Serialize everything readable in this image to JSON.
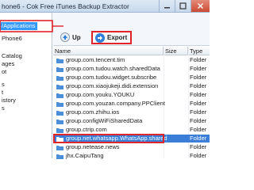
{
  "window": {
    "title": "hone6 - Cok Free iTunes Backup Extractor",
    "btn_minimize": "minimize-icon",
    "btn_maximize": "maximize-icon",
    "btn_close": "close-icon"
  },
  "tree": {
    "items": [
      {
        "label": "/Applications",
        "selected": true
      },
      {
        "label": "Phone6"
      },
      {
        "label": "Catalog"
      },
      {
        "label": "ages"
      },
      {
        "label": "ot"
      },
      {
        "label": "s"
      },
      {
        "label": "t"
      },
      {
        "label": "istory"
      },
      {
        "label": "s"
      }
    ]
  },
  "toolbar": {
    "up_label": "Up",
    "export_label": "Export",
    "up_icon": "up-arrow-icon",
    "export_icon": "export-icon"
  },
  "table": {
    "columns": {
      "name": "Name",
      "size": "Size",
      "type": "Type"
    },
    "rows": [
      {
        "name": "group.com.tencent.tim",
        "type": "Folder"
      },
      {
        "name": "group.com.tudou.watch.sharedData",
        "type": "Folder"
      },
      {
        "name": "group.com.tudou.widget.subscribe",
        "type": "Folder"
      },
      {
        "name": "group.com.xiaojukeji.didi.extension",
        "type": "Folder"
      },
      {
        "name": "group.com.youku.YOUKU",
        "type": "Folder"
      },
      {
        "name": "group.com.youzan.company.PPClient",
        "type": "Folder"
      },
      {
        "name": "group.com.zhihu.ios",
        "type": "Folder"
      },
      {
        "name": "group.configWiFiSharedData",
        "type": "Folder"
      },
      {
        "name": "group.ctrip.com",
        "type": "Folder"
      },
      {
        "name": "group.net.whatsapp.WhatsApp.shared",
        "type": "Folder",
        "selected": true
      },
      {
        "name": "group.netease.news",
        "type": "Folder"
      },
      {
        "name": "jhx.CaipuTang",
        "type": "Folder"
      }
    ]
  },
  "colors": {
    "highlight_red": "#e0242a",
    "selection_blue": "#3a7ed8",
    "folder_blue": "#4c8fd9"
  }
}
